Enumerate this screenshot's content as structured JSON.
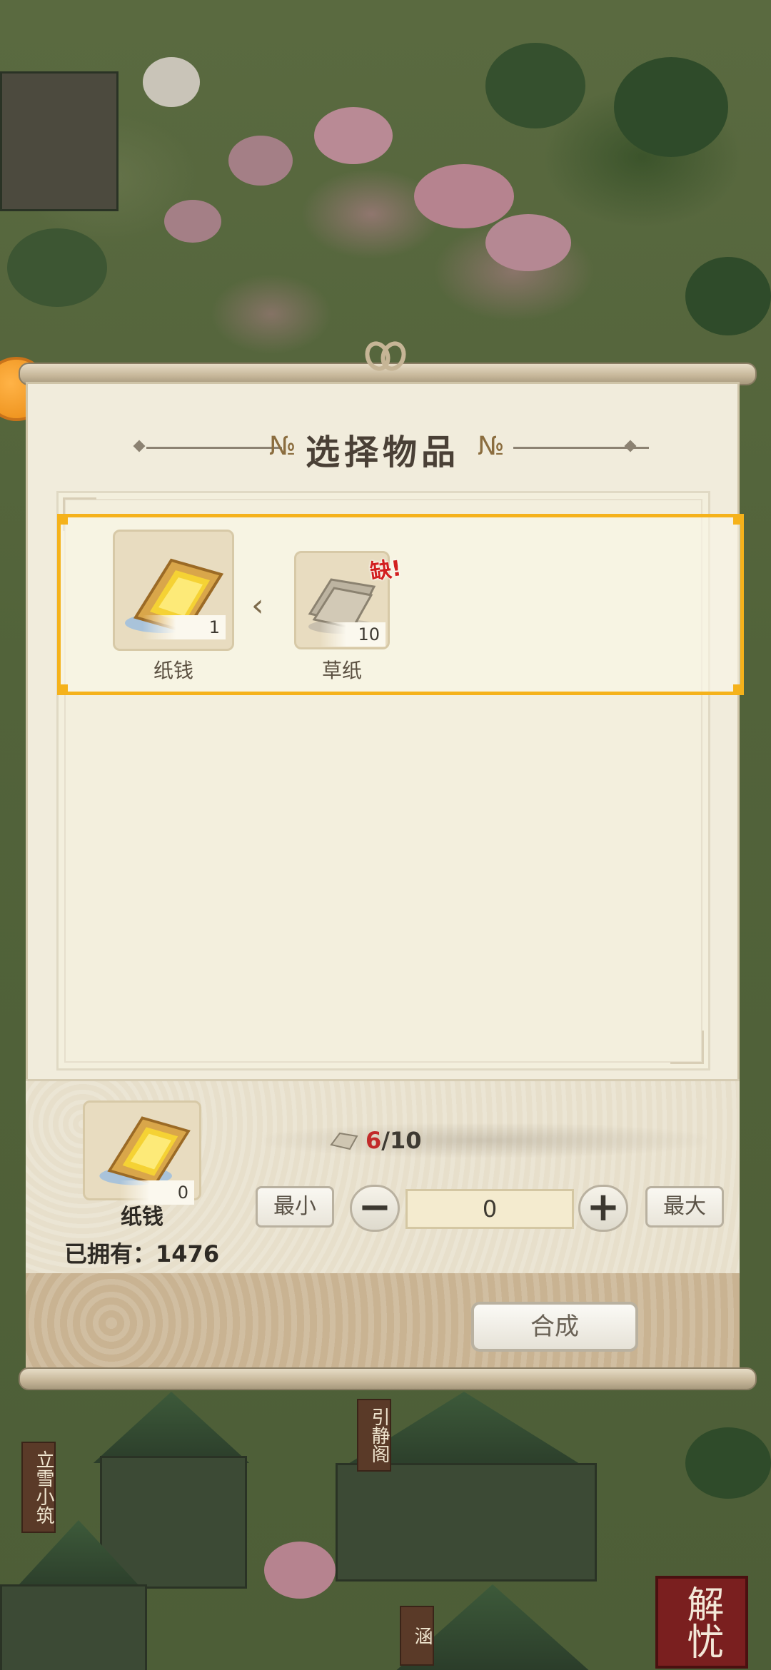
{
  "dialog": {
    "title": "选择物品"
  },
  "recipe": {
    "output": {
      "name": "纸钱",
      "count": "1",
      "icon": "gold-paper-icon"
    },
    "input": {
      "name": "草纸",
      "count": "10",
      "icon": "straw-paper-icon",
      "lack_badge": "缺!"
    }
  },
  "craft": {
    "selected_name": "纸钱",
    "selected_count": "0",
    "requirement_have": "6",
    "requirement_sep_total": "/10",
    "min_label": "最小",
    "max_label": "最大",
    "minus_label": "−",
    "plus_label": "+",
    "quantity": "0",
    "owned_label": "已拥有：",
    "owned_value": "1476",
    "craft_label": "合成"
  },
  "map": {
    "sign_left": "立雪小筑",
    "sign_mid": "引静阁",
    "sign_right": "涵",
    "seal_text": "解忧"
  },
  "colors": {
    "highlight": "#f5b21b",
    "lack_red": "#d21f1f",
    "panel_bg": "#f1ecdc"
  }
}
